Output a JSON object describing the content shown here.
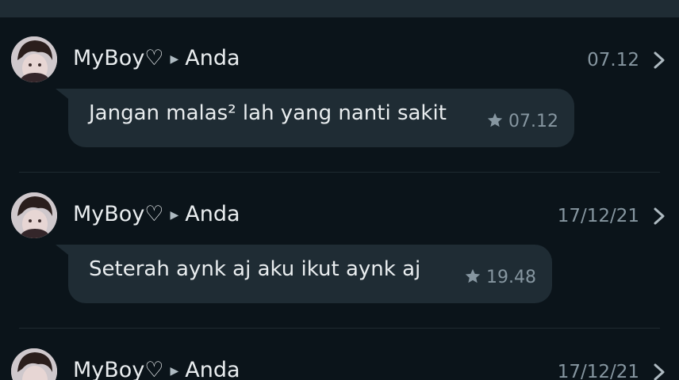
{
  "colors": {
    "background": "#0b141a",
    "bubble": "#1f2c34",
    "primary_text": "#e9edef",
    "secondary_text": "#8696a0"
  },
  "entries": [
    {
      "sender": "MyBoy♡",
      "recipient": "Anda",
      "date": "07.12",
      "message": "Jangan malas² lah yang nanti sakit",
      "time": "07.12",
      "icon": "star-icon"
    },
    {
      "sender": "MyBoy♡",
      "recipient": "Anda",
      "date": "17/12/21",
      "message": "Seterah aynk aj aku ikut aynk aj",
      "time": "19.48",
      "icon": "star-icon"
    },
    {
      "sender": "MyBoy♡",
      "recipient": "Anda",
      "date": "17/12/21"
    }
  ]
}
